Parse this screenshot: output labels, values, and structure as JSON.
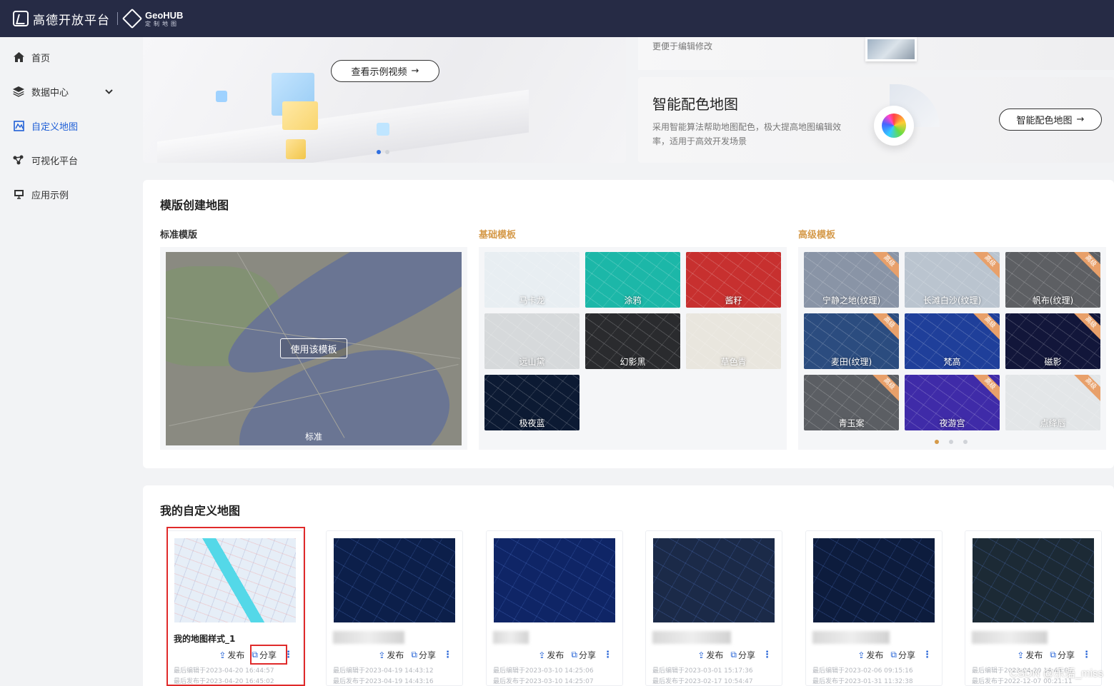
{
  "header": {
    "brand": "高德开放平台",
    "geohub_title": "GeoHUB",
    "geohub_sub": "定制地图"
  },
  "sidebar": {
    "items": [
      {
        "label": "首页",
        "icon": "home-icon",
        "active": false
      },
      {
        "label": "数据中心",
        "icon": "layers-icon",
        "active": false,
        "expandable": true
      },
      {
        "label": "自定义地图",
        "icon": "custom-map-icon",
        "active": true
      },
      {
        "label": "可视化平台",
        "icon": "visual-icon",
        "active": false
      },
      {
        "label": "应用示例",
        "icon": "monitor-icon",
        "active": false
      }
    ]
  },
  "banner": {
    "video_button": "查看示例视频",
    "edit_desc": "更便于编辑修改",
    "smart_title": "智能配色地图",
    "smart_desc": "采用智能算法帮助地图配色，极大提高地图编辑效率，适用于高效开发场景",
    "smart_button": "智能配色地图"
  },
  "templates": {
    "title": "模版创建地图",
    "standard_label": "标准模版",
    "basic_label": "基础模板",
    "advanced_label": "高级模板",
    "use_button": "使用该模板",
    "standard_name": "标准",
    "basic": [
      {
        "name": "马卡龙",
        "bg": "#e8eef2"
      },
      {
        "name": "涂鸦",
        "bg": "#1cb7a8"
      },
      {
        "name": "酱籽",
        "bg": "#c7302f"
      },
      {
        "name": "远山黛",
        "bg": "#d6d9db"
      },
      {
        "name": "幻影黑",
        "bg": "#2a2b2e"
      },
      {
        "name": "草色青",
        "bg": "#e9e6de"
      },
      {
        "name": "极夜蓝",
        "bg": "#0c1a33"
      }
    ],
    "advanced_badge": "高级",
    "advanced": [
      {
        "name": "宁静之地(纹理)",
        "bg": "#8994a6"
      },
      {
        "name": "长滩白沙(纹理)",
        "bg": "#bac4cf"
      },
      {
        "name": "帆布(纹理)",
        "bg": "#5d5f63"
      },
      {
        "name": "麦田(纹理)",
        "bg": "#2b4c7f"
      },
      {
        "name": "梵高",
        "bg": "#1f3f9a"
      },
      {
        "name": "磁影",
        "bg": "#12163a"
      },
      {
        "name": "青玉案",
        "bg": "#5b5e63"
      },
      {
        "name": "夜游宫",
        "bg": "#3f2ba8"
      },
      {
        "name": "点绛唇",
        "bg": "#e3e6e8"
      }
    ]
  },
  "my_maps": {
    "title": "我的自定义地图",
    "publish_label": "发布",
    "share_label": "分享",
    "more_label": "⋮",
    "cards": [
      {
        "name": "我的地图样式_1",
        "edited": "最后编辑于2023-04-20 16:44:57",
        "published": "最后发布于2023-04-20 16:45:02",
        "bg": "#e6eef7"
      },
      {
        "name": "",
        "edited": "最后编辑于2023-04-19 14:43:12",
        "published": "最后发布于2023-04-19 14:43:16",
        "bg": "#0c1f4a"
      },
      {
        "name": "",
        "edited": "最后编辑于2023-03-10 14:25:06",
        "published": "最后发布于2023-03-10 14:25:07",
        "bg": "#0f2566"
      },
      {
        "name": "",
        "edited": "最后编辑于2023-03-01 15:17:36",
        "published": "最后发布于2023-02-17 10:54:47",
        "bg": "#1b2a48"
      },
      {
        "name": "",
        "edited": "最后编辑于2023-02-06 09:15:16",
        "published": "最后发布于2023-01-31 11:32:38",
        "bg": "#0d1c3d"
      },
      {
        "name": "",
        "edited": "最后编辑于2023-04-20 14:43:01",
        "published": "最后发布于2022-12-07 00:21:11",
        "bg": "#1c2a35"
      }
    ]
  },
  "watermark": "CSDN @乐语_miss"
}
